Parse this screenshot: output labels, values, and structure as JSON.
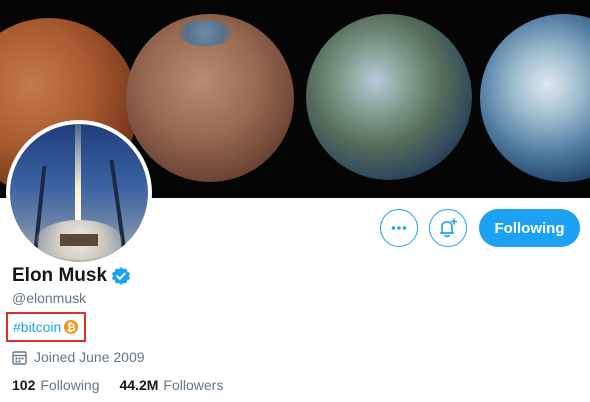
{
  "profile": {
    "name": "Elon Musk",
    "handle": "@elonmusk",
    "bio_hashtag": "#bitcoin",
    "bio_emoji": "₿",
    "joined": "Joined June 2009",
    "following_count": "102",
    "following_label": "Following",
    "followers_count": "44.2M",
    "followers_label": "Followers"
  },
  "actions": {
    "more_icon": "more-horizontal-icon",
    "notify_icon": "bell-plus-icon",
    "follow_label": "Following"
  },
  "icons": {
    "verified": "verified-badge-icon",
    "calendar": "calendar-icon",
    "bitcoin": "bitcoin-icon"
  },
  "colors": {
    "accent": "#1da1f2",
    "highlight_box": "#d9322c",
    "bitcoin": "#f7931a",
    "muted_text": "#657786"
  }
}
